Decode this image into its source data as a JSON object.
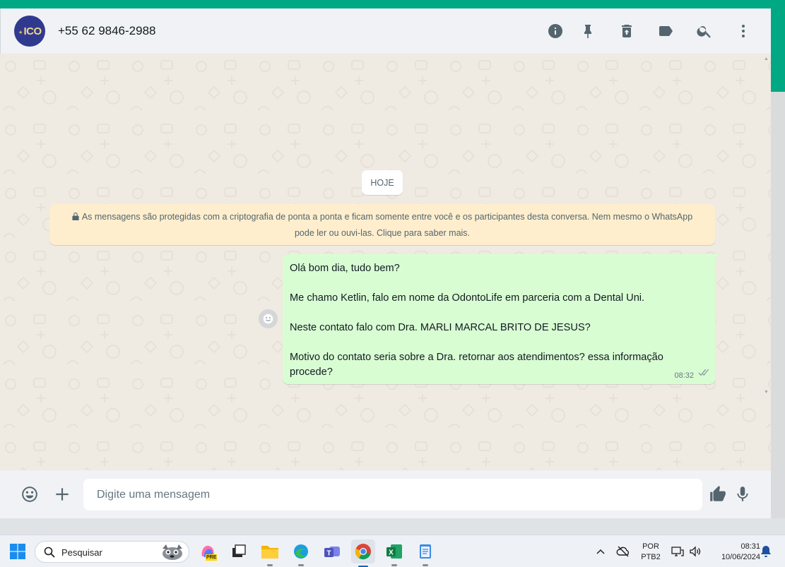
{
  "header": {
    "avatar_text": "ICO",
    "contact_name": "+55 62 9846-2988",
    "icons": [
      "info-icon",
      "pin-icon",
      "delete-icon",
      "label-icon",
      "search-icon",
      "menu-icon"
    ]
  },
  "chat": {
    "date_chip": "HOJE",
    "encryption_notice": "As mensagens são protegidas com a criptografia de ponta a ponta e ficam somente entre você e os participantes desta conversa. Nem mesmo o WhatsApp pode ler ou ouvi-las. Clique para saber mais.",
    "message": {
      "lines": [
        "Olá bom dia, tudo bem?",
        "Me chamo Ketlin, falo em nome da OdontoLife em parceria com a Dental Uni.",
        "Neste contato falo com Dra. MARLI MARCAL BRITO DE JESUS?",
        "Motivo do contato seria sobre a Dra. retornar aos atendimentos? essa informação procede?"
      ],
      "time": "08:32",
      "status": "double-check-icon"
    }
  },
  "composer": {
    "placeholder": "Digite uma mensagem",
    "icons": [
      "emoji-icon",
      "plus-icon",
      "thumbs-up-icon",
      "microphone-icon"
    ]
  },
  "taskbar": {
    "search_label": "Pesquisar",
    "language": "POR",
    "layout": "PTB2",
    "time": "08:31",
    "date": "10/06/2024",
    "copilot_badge": "PRE"
  },
  "colors": {
    "accent": "#00a884",
    "bubble_out": "#d9fdd3",
    "notice_bg": "#ffeecd",
    "chat_bg": "#efeae2"
  }
}
